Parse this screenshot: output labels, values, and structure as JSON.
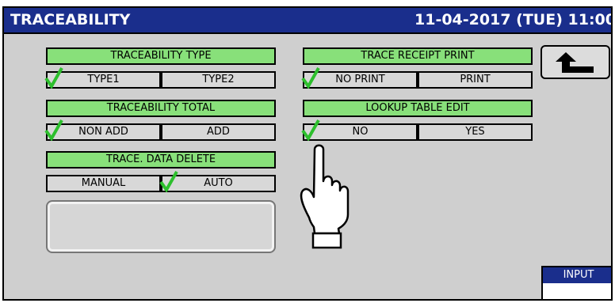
{
  "header": {
    "title": "TRACEABILITY",
    "datetime": "11-04-2017 (TUE) 11:00"
  },
  "groups": [
    {
      "label": "TRACEABILITY TYPE",
      "options": [
        "TYPE1",
        "TYPE2"
      ],
      "selected": 0
    },
    {
      "label": "TRACEABILITY TOTAL",
      "options": [
        "NON ADD",
        "ADD"
      ],
      "selected": 0
    },
    {
      "label": "TRACE. DATA DELETE",
      "options": [
        "MANUAL",
        "AUTO"
      ],
      "selected": 1
    },
    {
      "label": "TRACE RECEIPT PRINT",
      "options": [
        "NO PRINT",
        "PRINT"
      ],
      "selected": 0
    },
    {
      "label": "LOOKUP TABLE EDIT",
      "options": [
        "NO",
        "YES"
      ],
      "selected": 0
    }
  ],
  "back_button": {
    "icon": "back-arrow-icon"
  },
  "mode_indicator": {
    "label": "INPUT",
    "value": ""
  },
  "pointer": {
    "icon": "pointing-hand-icon"
  },
  "colors": {
    "title_bar": "#1a2e8c",
    "group_header": "#88e07a",
    "check_mark": "#2dbf2d",
    "screen_bg": "#cfcfcf"
  }
}
